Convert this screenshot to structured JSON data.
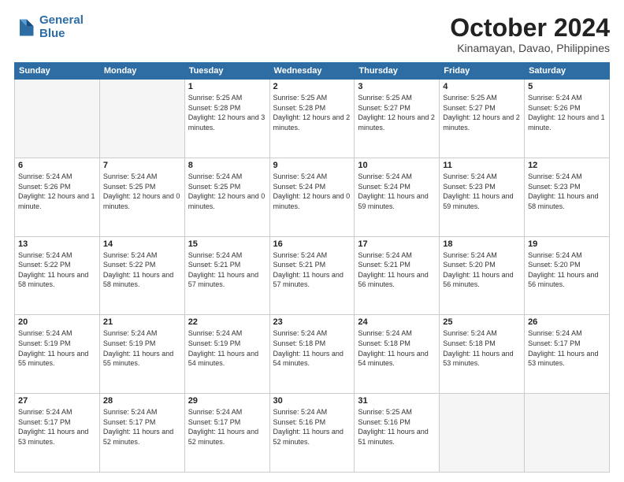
{
  "header": {
    "logo_line1": "General",
    "logo_line2": "Blue",
    "month": "October 2024",
    "location": "Kinamayan, Davao, Philippines"
  },
  "weekdays": [
    "Sunday",
    "Monday",
    "Tuesday",
    "Wednesday",
    "Thursday",
    "Friday",
    "Saturday"
  ],
  "weeks": [
    [
      {
        "day": "",
        "info": ""
      },
      {
        "day": "",
        "info": ""
      },
      {
        "day": "1",
        "info": "Sunrise: 5:25 AM\nSunset: 5:28 PM\nDaylight: 12 hours and 3 minutes."
      },
      {
        "day": "2",
        "info": "Sunrise: 5:25 AM\nSunset: 5:28 PM\nDaylight: 12 hours and 2 minutes."
      },
      {
        "day": "3",
        "info": "Sunrise: 5:25 AM\nSunset: 5:27 PM\nDaylight: 12 hours and 2 minutes."
      },
      {
        "day": "4",
        "info": "Sunrise: 5:25 AM\nSunset: 5:27 PM\nDaylight: 12 hours and 2 minutes."
      },
      {
        "day": "5",
        "info": "Sunrise: 5:24 AM\nSunset: 5:26 PM\nDaylight: 12 hours and 1 minute."
      }
    ],
    [
      {
        "day": "6",
        "info": "Sunrise: 5:24 AM\nSunset: 5:26 PM\nDaylight: 12 hours and 1 minute."
      },
      {
        "day": "7",
        "info": "Sunrise: 5:24 AM\nSunset: 5:25 PM\nDaylight: 12 hours and 0 minutes."
      },
      {
        "day": "8",
        "info": "Sunrise: 5:24 AM\nSunset: 5:25 PM\nDaylight: 12 hours and 0 minutes."
      },
      {
        "day": "9",
        "info": "Sunrise: 5:24 AM\nSunset: 5:24 PM\nDaylight: 12 hours and 0 minutes."
      },
      {
        "day": "10",
        "info": "Sunrise: 5:24 AM\nSunset: 5:24 PM\nDaylight: 11 hours and 59 minutes."
      },
      {
        "day": "11",
        "info": "Sunrise: 5:24 AM\nSunset: 5:23 PM\nDaylight: 11 hours and 59 minutes."
      },
      {
        "day": "12",
        "info": "Sunrise: 5:24 AM\nSunset: 5:23 PM\nDaylight: 11 hours and 58 minutes."
      }
    ],
    [
      {
        "day": "13",
        "info": "Sunrise: 5:24 AM\nSunset: 5:22 PM\nDaylight: 11 hours and 58 minutes."
      },
      {
        "day": "14",
        "info": "Sunrise: 5:24 AM\nSunset: 5:22 PM\nDaylight: 11 hours and 58 minutes."
      },
      {
        "day": "15",
        "info": "Sunrise: 5:24 AM\nSunset: 5:21 PM\nDaylight: 11 hours and 57 minutes."
      },
      {
        "day": "16",
        "info": "Sunrise: 5:24 AM\nSunset: 5:21 PM\nDaylight: 11 hours and 57 minutes."
      },
      {
        "day": "17",
        "info": "Sunrise: 5:24 AM\nSunset: 5:21 PM\nDaylight: 11 hours and 56 minutes."
      },
      {
        "day": "18",
        "info": "Sunrise: 5:24 AM\nSunset: 5:20 PM\nDaylight: 11 hours and 56 minutes."
      },
      {
        "day": "19",
        "info": "Sunrise: 5:24 AM\nSunset: 5:20 PM\nDaylight: 11 hours and 56 minutes."
      }
    ],
    [
      {
        "day": "20",
        "info": "Sunrise: 5:24 AM\nSunset: 5:19 PM\nDaylight: 11 hours and 55 minutes."
      },
      {
        "day": "21",
        "info": "Sunrise: 5:24 AM\nSunset: 5:19 PM\nDaylight: 11 hours and 55 minutes."
      },
      {
        "day": "22",
        "info": "Sunrise: 5:24 AM\nSunset: 5:19 PM\nDaylight: 11 hours and 54 minutes."
      },
      {
        "day": "23",
        "info": "Sunrise: 5:24 AM\nSunset: 5:18 PM\nDaylight: 11 hours and 54 minutes."
      },
      {
        "day": "24",
        "info": "Sunrise: 5:24 AM\nSunset: 5:18 PM\nDaylight: 11 hours and 54 minutes."
      },
      {
        "day": "25",
        "info": "Sunrise: 5:24 AM\nSunset: 5:18 PM\nDaylight: 11 hours and 53 minutes."
      },
      {
        "day": "26",
        "info": "Sunrise: 5:24 AM\nSunset: 5:17 PM\nDaylight: 11 hours and 53 minutes."
      }
    ],
    [
      {
        "day": "27",
        "info": "Sunrise: 5:24 AM\nSunset: 5:17 PM\nDaylight: 11 hours and 53 minutes."
      },
      {
        "day": "28",
        "info": "Sunrise: 5:24 AM\nSunset: 5:17 PM\nDaylight: 11 hours and 52 minutes."
      },
      {
        "day": "29",
        "info": "Sunrise: 5:24 AM\nSunset: 5:17 PM\nDaylight: 11 hours and 52 minutes."
      },
      {
        "day": "30",
        "info": "Sunrise: 5:24 AM\nSunset: 5:16 PM\nDaylight: 11 hours and 52 minutes."
      },
      {
        "day": "31",
        "info": "Sunrise: 5:25 AM\nSunset: 5:16 PM\nDaylight: 11 hours and 51 minutes."
      },
      {
        "day": "",
        "info": ""
      },
      {
        "day": "",
        "info": ""
      }
    ]
  ]
}
